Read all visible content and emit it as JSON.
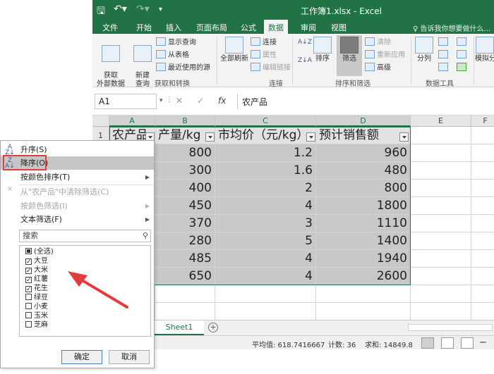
{
  "window": {
    "title": "工作簿1.xlsx - Excel",
    "tell_me": "♀ 告诉我你想要做什么..."
  },
  "tabs": [
    "文件",
    "开始",
    "插入",
    "页面布局",
    "公式",
    "数据",
    "审阅",
    "视图"
  ],
  "active_tab": "数据",
  "ribbon": {
    "get_external": "获取\n外部数据",
    "new_query": "新建\n查询",
    "show_query": "显示查询",
    "from_table": "从表格",
    "recent_sources": "最近使用的源",
    "group_get_transform": "获取和转换",
    "refresh_all": "全部刷新",
    "connections": "连接",
    "properties": "属性",
    "edit_links": "编辑链接",
    "group_connections": "连接",
    "sort": "排序",
    "filter": "筛选",
    "clear": "清除",
    "reapply": "重新应用",
    "advanced": "高级",
    "group_sort_filter": "排序和筛选",
    "split": "分列",
    "group_data_tools": "数据工具",
    "simulate": "模拟分"
  },
  "formula_bar": {
    "name_box": "A1",
    "fx": "fx",
    "content": "农产品"
  },
  "columns": [
    "A",
    "B",
    "C",
    "D",
    "E",
    "F"
  ],
  "rows": [
    "1"
  ],
  "table": {
    "headers": [
      "农产品",
      "产量/kg",
      "市均价（元/kg）",
      "预计销售额"
    ],
    "rows": [
      [
        "800",
        "1.2",
        "960"
      ],
      [
        "300",
        "1.6",
        "480"
      ],
      [
        "400",
        "2",
        "800"
      ],
      [
        "450",
        "4",
        "1800"
      ],
      [
        "370",
        "3",
        "1110"
      ],
      [
        "280",
        "5",
        "1400"
      ],
      [
        "485",
        "4",
        "1940"
      ],
      [
        "650",
        "4",
        "2600"
      ]
    ]
  },
  "sheet": {
    "tab": "Sheet1",
    "add": "+"
  },
  "status": {
    "average": "平均值: 618.7416667",
    "count": "计数: 36",
    "sum": "求和: 14849.8"
  },
  "filter_menu": {
    "sort_asc": "升序(S)",
    "sort_desc": "降序(O)",
    "sort_by_color": "按颜色排序(T)",
    "clear_filter": "从\"农产品\"中清除筛选(C)",
    "filter_by_color": "按颜色筛选(I)",
    "text_filter": "文本筛选(F)",
    "search_placeholder": "搜索",
    "items": [
      {
        "label": "(全选)",
        "state": "partial"
      },
      {
        "label": "大豆",
        "state": "checked"
      },
      {
        "label": "大米",
        "state": "checked"
      },
      {
        "label": "红薯",
        "state": "checked"
      },
      {
        "label": "花生",
        "state": "checked"
      },
      {
        "label": "绿豆",
        "state": "unchecked"
      },
      {
        "label": "小麦",
        "state": "unchecked"
      },
      {
        "label": "玉米",
        "state": "unchecked"
      },
      {
        "label": "芝麻",
        "state": "unchecked"
      }
    ],
    "ok": "确定",
    "cancel": "取消"
  },
  "colors": {
    "excel_green": "#217346",
    "highlight_red": "#e23c3c"
  }
}
